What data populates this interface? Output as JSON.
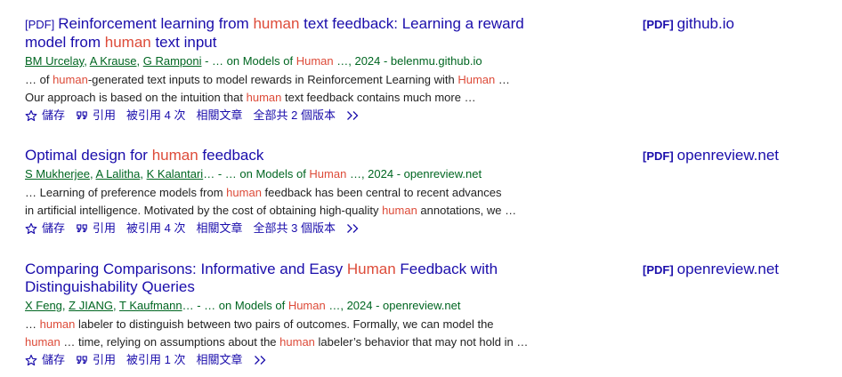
{
  "results": [
    {
      "title_prefix": "[PDF]",
      "title_line1": [
        {
          "t": "Reinforcement learning from ",
          "hl": false
        },
        {
          "t": "human",
          "hl": true
        },
        {
          "t": " text feedback: Learning a reward",
          "hl": false
        }
      ],
      "title_line2": [
        {
          "t": "model from ",
          "hl": false
        },
        {
          "t": "human",
          "hl": true
        },
        {
          "t": " text input",
          "hl": false
        }
      ],
      "authors": [
        "BM Urcelay",
        "A Krause",
        "G Ramponi"
      ],
      "authors_suffix": [
        {
          "t": " - … on Models of ",
          "hl": false
        },
        {
          "t": "Human",
          "hl": true
        },
        {
          "t": " …, 2024 - belenmu.github.io",
          "hl": false
        }
      ],
      "snippet_line1": [
        {
          "t": "… of ",
          "hl": false
        },
        {
          "t": "human",
          "hl": true
        },
        {
          "t": "-generated text inputs to model rewards in Reinforcement Learning with ",
          "hl": false
        },
        {
          "t": "Human",
          "hl": true
        },
        {
          "t": " …",
          "hl": false
        }
      ],
      "snippet_line2": [
        {
          "t": "Our approach is based on the intuition that ",
          "hl": false
        },
        {
          "t": "human",
          "hl": true
        },
        {
          "t": " text feedback contains much more …",
          "hl": false
        }
      ],
      "actions": {
        "save": "儲存",
        "cite": "引用",
        "cited_by": "被引用 4 次",
        "related": "相關文章",
        "versions": "全部共 2 個版本"
      },
      "side_tag": "[PDF]",
      "side_source": "github.io"
    },
    {
      "title_prefix": "",
      "title_line1": [
        {
          "t": "Optimal design for ",
          "hl": false
        },
        {
          "t": "human",
          "hl": true
        },
        {
          "t": " feedback",
          "hl": false
        }
      ],
      "title_line2": [],
      "authors": [
        "S Mukherjee",
        "A Lalitha",
        "K Kalantari"
      ],
      "authors_suffix": [
        {
          "t": "… - … on Models of ",
          "hl": false
        },
        {
          "t": "Human",
          "hl": true
        },
        {
          "t": " …, 2024 - openreview.net",
          "hl": false
        }
      ],
      "snippet_line1": [
        {
          "t": "… Learning of preference models from ",
          "hl": false
        },
        {
          "t": "human",
          "hl": true
        },
        {
          "t": " feedback has been central to recent advances",
          "hl": false
        }
      ],
      "snippet_line2": [
        {
          "t": "in artificial intelligence. Motivated by the cost of obtaining high-quality ",
          "hl": false
        },
        {
          "t": "human",
          "hl": true
        },
        {
          "t": " annotations, we …",
          "hl": false
        }
      ],
      "actions": {
        "save": "儲存",
        "cite": "引用",
        "cited_by": "被引用 4 次",
        "related": "相關文章",
        "versions": "全部共 3 個版本"
      },
      "side_tag": "[PDF]",
      "side_source": "openreview.net"
    },
    {
      "title_prefix": "",
      "title_line1": [
        {
          "t": "Comparing Comparisons: Informative and Easy ",
          "hl": false
        },
        {
          "t": "Human",
          "hl": true
        },
        {
          "t": " Feedback with",
          "hl": false
        }
      ],
      "title_line2": [
        {
          "t": "Distinguishability Queries",
          "hl": false
        }
      ],
      "authors": [
        "X Feng",
        "Z JIANG",
        "T Kaufmann"
      ],
      "authors_suffix": [
        {
          "t": "… - … on Models of ",
          "hl": false
        },
        {
          "t": "Human",
          "hl": true
        },
        {
          "t": " …, 2024 - openreview.net",
          "hl": false
        }
      ],
      "snippet_line1": [
        {
          "t": "… ",
          "hl": false
        },
        {
          "t": "human",
          "hl": true
        },
        {
          "t": " labeler to distinguish between two pairs of outcomes. Formally, we can model the",
          "hl": false
        }
      ],
      "snippet_line2": [
        {
          "t": "human",
          "hl": true
        },
        {
          "t": " … time, relying on assumptions about the ",
          "hl": false
        },
        {
          "t": "human",
          "hl": true
        },
        {
          "t": " labeler’s behavior that may not hold in …",
          "hl": false
        }
      ],
      "actions": {
        "save": "儲存",
        "cite": "引用",
        "cited_by": "被引用 1 次",
        "related": "相關文章",
        "versions": ""
      },
      "side_tag": "[PDF]",
      "side_source": "openreview.net"
    }
  ],
  "icons": {
    "save": "star-outline-icon",
    "cite": "quote-icon",
    "more": "double-chevron-right-icon"
  },
  "colors": {
    "link": "#1a0dab",
    "highlight": "#dd4b39",
    "source_green": "#006621",
    "text": "#222222"
  }
}
